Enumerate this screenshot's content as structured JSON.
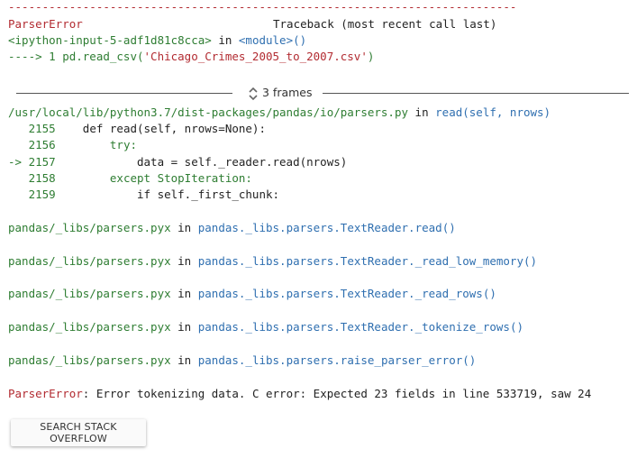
{
  "traceback": {
    "dashes": "---------------------------------------------------------------------------",
    "error_type": "ParserError",
    "header_right": "Traceback (most recent call last)",
    "input_ref": "<ipython-input-5-adf1d81c8cca>",
    "in_word": "in",
    "module_ref": "<module>()",
    "call_prefix": "----> 1 pd.read_csv(",
    "call_arg": "'Chicago_Crimes_2005_to_2007.csv'",
    "call_suffix": ")"
  },
  "frames_toggle": {
    "label": "3 frames",
    "icon": "unfold-icon"
  },
  "frame1": {
    "path": "/usr/local/lib/python3.7/dist-packages/pandas/io/parsers.py",
    "in_word": "in",
    "func": "read",
    "args": "(self, nrows)",
    "lines": [
      {
        "marker": "   ",
        "num": "2155",
        "code": "    def read(self, nrows=None):"
      },
      {
        "marker": "   ",
        "num": "2156",
        "code": "        try:"
      },
      {
        "marker": "-> ",
        "num": "2157",
        "code": "            data = self._reader.read(nrows)"
      },
      {
        "marker": "   ",
        "num": "2158",
        "code": "        except StopIteration:"
      },
      {
        "marker": "   ",
        "num": "2159",
        "code": "            if self._first_chunk:"
      }
    ]
  },
  "cython_frames": [
    {
      "file": "pandas/_libs/parsers.pyx",
      "in_word": "in",
      "func": "pandas._libs.parsers.TextReader.read",
      "parens": "()"
    },
    {
      "file": "pandas/_libs/parsers.pyx",
      "in_word": "in",
      "func": "pandas._libs.parsers.TextReader._read_low_memory",
      "parens": "()"
    },
    {
      "file": "pandas/_libs/parsers.pyx",
      "in_word": "in",
      "func": "pandas._libs.parsers.TextReader._read_rows",
      "parens": "()"
    },
    {
      "file": "pandas/_libs/parsers.pyx",
      "in_word": "in",
      "func": "pandas._libs.parsers.TextReader._tokenize_rows",
      "parens": "()"
    },
    {
      "file": "pandas/_libs/parsers.pyx",
      "in_word": "in",
      "func": "pandas._libs.parsers.raise_parser_error",
      "parens": "()"
    }
  ],
  "error_line": {
    "type": "ParserError",
    "message": ": Error tokenizing data. C error: Expected 23 fields in line 533719, saw 24"
  },
  "button": {
    "label": "SEARCH STACK OVERFLOW"
  },
  "colors": {
    "error": "#b22b31",
    "path": "#2e7d32",
    "func": "#2f6fb0"
  }
}
